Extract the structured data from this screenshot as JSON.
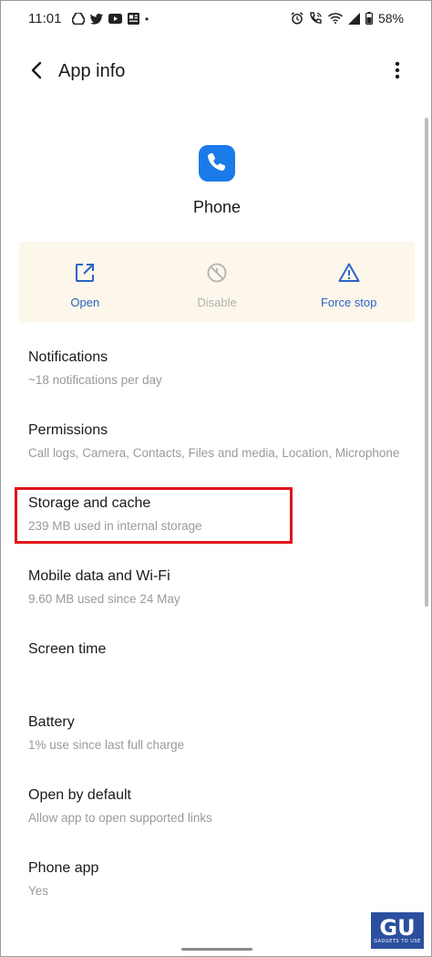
{
  "status_bar": {
    "time": "11:01",
    "dot": "•",
    "battery_percent": "58%",
    "left_icons": [
      "drive-icon",
      "twitter-icon",
      "youtube-icon",
      "news-icon"
    ],
    "right_icons": [
      "alarm-icon",
      "wifi-call-icon",
      "wifi-icon",
      "signal-icon",
      "battery-icon"
    ]
  },
  "app_bar": {
    "title": "App info",
    "back_icon": "back-arrow-icon",
    "menu_icon": "more-vert-icon"
  },
  "app": {
    "name": "Phone",
    "icon": "phone-icon",
    "icon_color": "#1a7be8"
  },
  "actions": [
    {
      "label": "Open",
      "icon": "open-external-icon",
      "enabled": true
    },
    {
      "label": "Disable",
      "icon": "disable-icon",
      "enabled": false
    },
    {
      "label": "Force stop",
      "icon": "warning-icon",
      "enabled": true
    }
  ],
  "settings": [
    {
      "title": "Notifications",
      "subtitle": "~18 notifications per day"
    },
    {
      "title": "Permissions",
      "subtitle": "Call logs, Camera, Contacts, Files and media, Location, Microphone"
    },
    {
      "title": "Storage and cache",
      "subtitle": "239 MB used in internal storage"
    },
    {
      "title": "Mobile data and Wi-Fi",
      "subtitle": "9.60 MB used since 24 May"
    },
    {
      "title": "Screen time",
      "subtitle": ""
    },
    {
      "title": "Battery",
      "subtitle": "1% use since last full charge"
    },
    {
      "title": "Open by default",
      "subtitle": "Allow app to open supported links"
    },
    {
      "title": "Phone app",
      "subtitle": "Yes"
    }
  ],
  "colors": {
    "accent": "#2a64c6",
    "highlight": "#e0141c",
    "action_panel_bg": "#fdf6ea"
  },
  "watermark": {
    "glyph": "GU",
    "text": "GADGETS TO USE"
  }
}
